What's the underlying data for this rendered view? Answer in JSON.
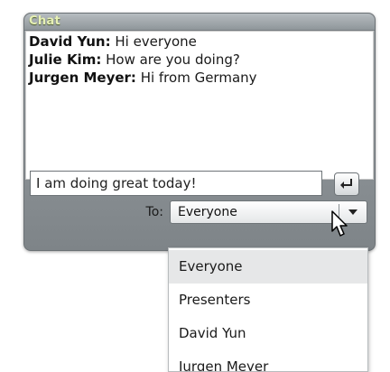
{
  "panel": {
    "title": "Chat"
  },
  "messages": [
    {
      "sender": "David Yun:",
      "text": " Hi everyone"
    },
    {
      "sender": "Julie Kim:",
      "text": " How are you doing?"
    },
    {
      "sender": "Jurgen Meyer:",
      "text": " Hi from Germany"
    }
  ],
  "composer": {
    "input_value": "I am doing great today!",
    "send_icon": "enter-icon",
    "to_label": "To:",
    "recipient_selected": "Everyone"
  },
  "recipient_options": [
    {
      "label": "Everyone",
      "selected": true
    },
    {
      "label": "Presenters",
      "selected": false
    },
    {
      "label": "David Yun",
      "selected": false
    },
    {
      "label": "Jurgen Meyer",
      "selected": false
    }
  ],
  "colors": {
    "title": "#e6f0b4",
    "panel": "#8e9498",
    "selected_option": "#e6e7e8"
  }
}
